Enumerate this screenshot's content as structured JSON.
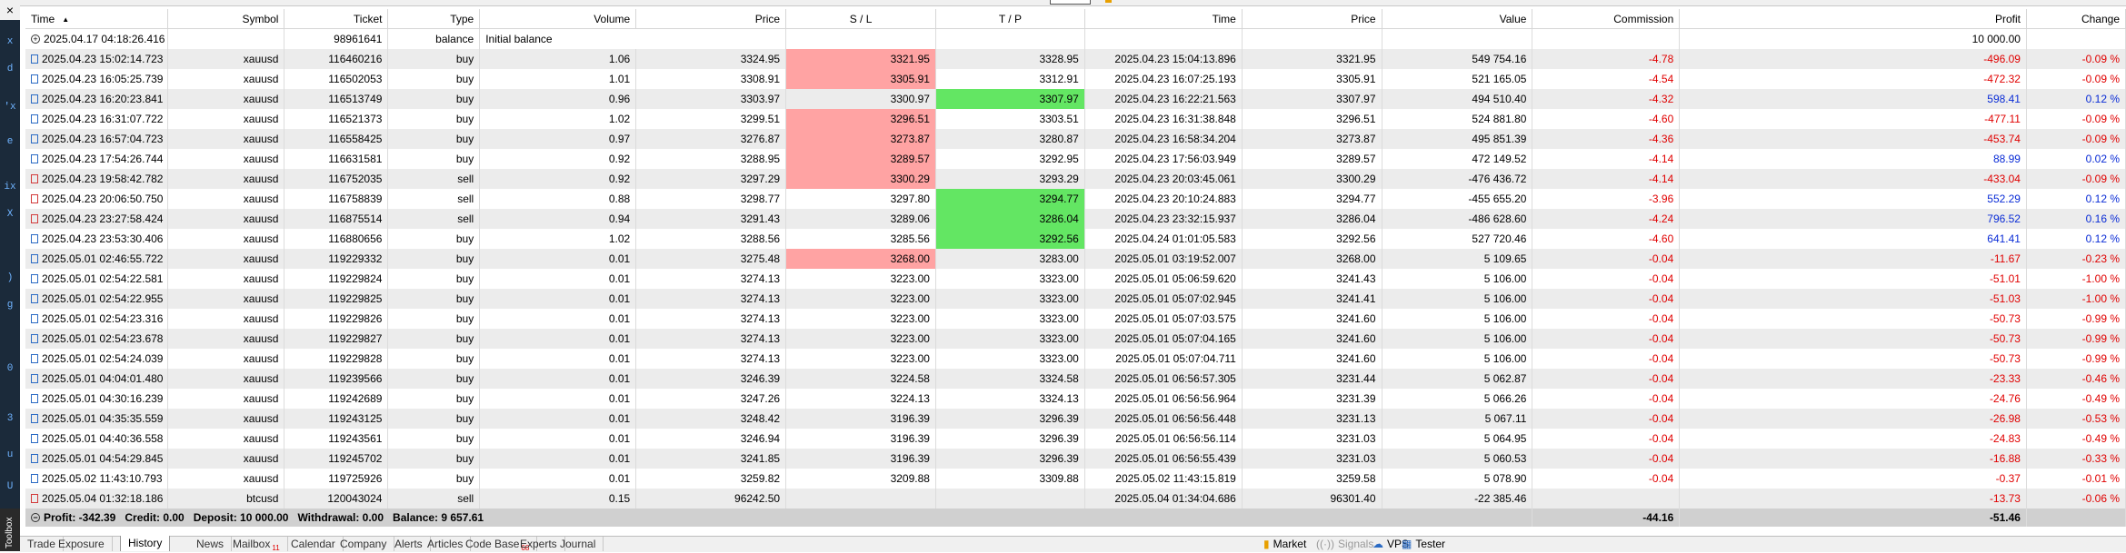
{
  "columns": [
    "Time",
    "Symbol",
    "Ticket",
    "Type",
    "Volume",
    "Price",
    "S / L",
    "T / P",
    "Time",
    "Price",
    "Value",
    "Commission",
    "Profit",
    "Change"
  ],
  "balance_row": {
    "time": "2025.04.17 04:18:26.416",
    "ticket": "98961641",
    "type": "balance",
    "comment": "Initial balance",
    "profit": "10 000.00"
  },
  "rows": [
    {
      "time": "2025.04.23 15:02:14.723",
      "symbol": "xauusd",
      "ticket": "116460216",
      "type": "buy",
      "volume": "1.06",
      "price": "3324.95",
      "sl": "3321.95",
      "tp": "3328.95",
      "time2": "2025.04.23 15:04:13.896",
      "price2": "3321.95",
      "value": "549 754.16",
      "commission": "-4.78",
      "profit": "-496.09",
      "change": "-0.09 %",
      "hit": "sl"
    },
    {
      "time": "2025.04.23 16:05:25.739",
      "symbol": "xauusd",
      "ticket": "116502053",
      "type": "buy",
      "volume": "1.01",
      "price": "3308.91",
      "sl": "3305.91",
      "tp": "3312.91",
      "time2": "2025.04.23 16:07:25.193",
      "price2": "3305.91",
      "value": "521 165.05",
      "commission": "-4.54",
      "profit": "-472.32",
      "change": "-0.09 %",
      "hit": "sl"
    },
    {
      "time": "2025.04.23 16:20:23.841",
      "symbol": "xauusd",
      "ticket": "116513749",
      "type": "buy",
      "volume": "0.96",
      "price": "3303.97",
      "sl": "3300.97",
      "tp": "3307.97",
      "time2": "2025.04.23 16:22:21.563",
      "price2": "3307.97",
      "value": "494 510.40",
      "commission": "-4.32",
      "profit": "598.41",
      "change": "0.12 %",
      "hit": "tp"
    },
    {
      "time": "2025.04.23 16:31:07.722",
      "symbol": "xauusd",
      "ticket": "116521373",
      "type": "buy",
      "volume": "1.02",
      "price": "3299.51",
      "sl": "3296.51",
      "tp": "3303.51",
      "time2": "2025.04.23 16:31:38.848",
      "price2": "3296.51",
      "value": "524 881.80",
      "commission": "-4.60",
      "profit": "-477.11",
      "change": "-0.09 %",
      "hit": "sl"
    },
    {
      "time": "2025.04.23 16:57:04.723",
      "symbol": "xauusd",
      "ticket": "116558425",
      "type": "buy",
      "volume": "0.97",
      "price": "3276.87",
      "sl": "3273.87",
      "tp": "3280.87",
      "time2": "2025.04.23 16:58:34.204",
      "price2": "3273.87",
      "value": "495 851.39",
      "commission": "-4.36",
      "profit": "-453.74",
      "change": "-0.09 %",
      "hit": "sl"
    },
    {
      "time": "2025.04.23 17:54:26.744",
      "symbol": "xauusd",
      "ticket": "116631581",
      "type": "buy",
      "volume": "0.92",
      "price": "3288.95",
      "sl": "3289.57",
      "tp": "3292.95",
      "time2": "2025.04.23 17:56:03.949",
      "price2": "3289.57",
      "value": "472 149.52",
      "commission": "-4.14",
      "profit": "88.99",
      "change": "0.02 %",
      "hit": "sl"
    },
    {
      "time": "2025.04.23 19:58:42.782",
      "symbol": "xauusd",
      "ticket": "116752035",
      "type": "sell",
      "volume": "0.92",
      "price": "3297.29",
      "sl": "3300.29",
      "tp": "3293.29",
      "time2": "2025.04.23 20:03:45.061",
      "price2": "3300.29",
      "value": "-476 436.72",
      "commission": "-4.14",
      "profit": "-433.04",
      "change": "-0.09 %",
      "hit": "sl"
    },
    {
      "time": "2025.04.23 20:06:50.750",
      "symbol": "xauusd",
      "ticket": "116758839",
      "type": "sell",
      "volume": "0.88",
      "price": "3298.77",
      "sl": "3297.80",
      "tp": "3294.77",
      "time2": "2025.04.23 20:10:24.883",
      "price2": "3294.77",
      "value": "-455 655.20",
      "commission": "-3.96",
      "profit": "552.29",
      "change": "0.12 %",
      "hit": "tp"
    },
    {
      "time": "2025.04.23 23:27:58.424",
      "symbol": "xauusd",
      "ticket": "116875514",
      "type": "sell",
      "volume": "0.94",
      "price": "3291.43",
      "sl": "3289.06",
      "tp": "3286.04",
      "time2": "2025.04.23 23:32:15.937",
      "price2": "3286.04",
      "value": "-486 628.60",
      "commission": "-4.24",
      "profit": "796.52",
      "change": "0.16 %",
      "hit": "tp"
    },
    {
      "time": "2025.04.23 23:53:30.406",
      "symbol": "xauusd",
      "ticket": "116880656",
      "type": "buy",
      "volume": "1.02",
      "price": "3288.56",
      "sl": "3285.56",
      "tp": "3292.56",
      "time2": "2025.04.24 01:01:05.583",
      "price2": "3292.56",
      "value": "527 720.46",
      "commission": "-4.60",
      "profit": "641.41",
      "change": "0.12 %",
      "hit": "tp"
    },
    {
      "time": "2025.05.01 02:46:55.722",
      "symbol": "xauusd",
      "ticket": "119229332",
      "type": "buy",
      "volume": "0.01",
      "price": "3275.48",
      "sl": "3268.00",
      "tp": "3283.00",
      "time2": "2025.05.01 03:19:52.007",
      "price2": "3268.00",
      "value": "5 109.65",
      "commission": "-0.04",
      "profit": "-11.67",
      "change": "-0.23 %",
      "hit": "sl"
    },
    {
      "time": "2025.05.01 02:54:22.581",
      "symbol": "xauusd",
      "ticket": "119229824",
      "type": "buy",
      "volume": "0.01",
      "price": "3274.13",
      "sl": "3223.00",
      "tp": "3323.00",
      "time2": "2025.05.01 05:06:59.620",
      "price2": "3241.43",
      "value": "5 106.00",
      "commission": "-0.04",
      "profit": "-51.01",
      "change": "-1.00 %",
      "hit": ""
    },
    {
      "time": "2025.05.01 02:54:22.955",
      "symbol": "xauusd",
      "ticket": "119229825",
      "type": "buy",
      "volume": "0.01",
      "price": "3274.13",
      "sl": "3223.00",
      "tp": "3323.00",
      "time2": "2025.05.01 05:07:02.945",
      "price2": "3241.41",
      "value": "5 106.00",
      "commission": "-0.04",
      "profit": "-51.03",
      "change": "-1.00 %",
      "hit": ""
    },
    {
      "time": "2025.05.01 02:54:23.316",
      "symbol": "xauusd",
      "ticket": "119229826",
      "type": "buy",
      "volume": "0.01",
      "price": "3274.13",
      "sl": "3223.00",
      "tp": "3323.00",
      "time2": "2025.05.01 05:07:03.575",
      "price2": "3241.60",
      "value": "5 106.00",
      "commission": "-0.04",
      "profit": "-50.73",
      "change": "-0.99 %",
      "hit": ""
    },
    {
      "time": "2025.05.01 02:54:23.678",
      "symbol": "xauusd",
      "ticket": "119229827",
      "type": "buy",
      "volume": "0.01",
      "price": "3274.13",
      "sl": "3223.00",
      "tp": "3323.00",
      "time2": "2025.05.01 05:07:04.165",
      "price2": "3241.60",
      "value": "5 106.00",
      "commission": "-0.04",
      "profit": "-50.73",
      "change": "-0.99 %",
      "hit": ""
    },
    {
      "time": "2025.05.01 02:54:24.039",
      "symbol": "xauusd",
      "ticket": "119229828",
      "type": "buy",
      "volume": "0.01",
      "price": "3274.13",
      "sl": "3223.00",
      "tp": "3323.00",
      "time2": "2025.05.01 05:07:04.711",
      "price2": "3241.60",
      "value": "5 106.00",
      "commission": "-0.04",
      "profit": "-50.73",
      "change": "-0.99 %",
      "hit": ""
    },
    {
      "time": "2025.05.01 04:04:01.480",
      "symbol": "xauusd",
      "ticket": "119239566",
      "type": "buy",
      "volume": "0.01",
      "price": "3246.39",
      "sl": "3224.58",
      "tp": "3324.58",
      "time2": "2025.05.01 06:56:57.305",
      "price2": "3231.44",
      "value": "5 062.87",
      "commission": "-0.04",
      "profit": "-23.33",
      "change": "-0.46 %",
      "hit": ""
    },
    {
      "time": "2025.05.01 04:30:16.239",
      "symbol": "xauusd",
      "ticket": "119242689",
      "type": "buy",
      "volume": "0.01",
      "price": "3247.26",
      "sl": "3224.13",
      "tp": "3324.13",
      "time2": "2025.05.01 06:56:56.964",
      "price2": "3231.39",
      "value": "5 066.26",
      "commission": "-0.04",
      "profit": "-24.76",
      "change": "-0.49 %",
      "hit": ""
    },
    {
      "time": "2025.05.01 04:35:35.559",
      "symbol": "xauusd",
      "ticket": "119243125",
      "type": "buy",
      "volume": "0.01",
      "price": "3248.42",
      "sl": "3196.39",
      "tp": "3296.39",
      "time2": "2025.05.01 06:56:56.448",
      "price2": "3231.13",
      "value": "5 067.11",
      "commission": "-0.04",
      "profit": "-26.98",
      "change": "-0.53 %",
      "hit": ""
    },
    {
      "time": "2025.05.01 04:40:36.558",
      "symbol": "xauusd",
      "ticket": "119243561",
      "type": "buy",
      "volume": "0.01",
      "price": "3246.94",
      "sl": "3196.39",
      "tp": "3296.39",
      "time2": "2025.05.01 06:56:56.114",
      "price2": "3231.03",
      "value": "5 064.95",
      "commission": "-0.04",
      "profit": "-24.83",
      "change": "-0.49 %",
      "hit": ""
    },
    {
      "time": "2025.05.01 04:54:29.845",
      "symbol": "xauusd",
      "ticket": "119245702",
      "type": "buy",
      "volume": "0.01",
      "price": "3241.85",
      "sl": "3196.39",
      "tp": "3296.39",
      "time2": "2025.05.01 06:56:55.439",
      "price2": "3231.03",
      "value": "5 060.53",
      "commission": "-0.04",
      "profit": "-16.88",
      "change": "-0.33 %",
      "hit": ""
    },
    {
      "time": "2025.05.02 11:43:10.793",
      "symbol": "xauusd",
      "ticket": "119725926",
      "type": "buy",
      "volume": "0.01",
      "price": "3259.82",
      "sl": "3209.88",
      "tp": "3309.88",
      "time2": "2025.05.02 11:43:15.819",
      "price2": "3259.58",
      "value": "5 078.90",
      "commission": "-0.04",
      "profit": "-0.37",
      "change": "-0.01 %",
      "hit": ""
    },
    {
      "time": "2025.05.04 01:32:18.186",
      "symbol": "btcusd",
      "ticket": "120043024",
      "type": "sell",
      "volume": "0.15",
      "price": "96242.50",
      "sl": "",
      "tp": "",
      "time2": "2025.05.04 01:34:04.686",
      "price2": "96301.40",
      "value": "-22 385.46",
      "commission": "",
      "profit": "-13.73",
      "change": "-0.06 %",
      "hit": ""
    }
  ],
  "summary": {
    "label": "Profit: -342.39   Credit: 0.00   Deposit: 10 000.00   Withdrawal: 0.00   Balance: 9 657.61",
    "commission": "-44.16",
    "profit": "-51.46"
  },
  "tabs": [
    {
      "label": "Trade",
      "badge": ""
    },
    {
      "label": "Exposure",
      "badge": ""
    },
    {
      "label": "History",
      "badge": "",
      "active": true
    },
    {
      "label": "News",
      "badge": ""
    },
    {
      "label": "Mailbox",
      "badge": "11"
    },
    {
      "label": "Calendar",
      "badge": ""
    },
    {
      "label": "Company",
      "badge": ""
    },
    {
      "label": "Alerts",
      "badge": ""
    },
    {
      "label": "Articles",
      "badge": ""
    },
    {
      "label": "Code Base",
      "badge": "68"
    },
    {
      "label": "Experts",
      "badge": ""
    },
    {
      "label": "Journal",
      "badge": ""
    }
  ],
  "status": {
    "market": "Market",
    "signals": "Signals",
    "vps": "VPS",
    "tester": "Tester"
  },
  "toolbox_label": "Toolbox",
  "colors": {
    "sl_hit": "#ffa3a3",
    "tp_hit": "#63e663",
    "loss": "#e00000",
    "gain": "#0a2cd6"
  }
}
